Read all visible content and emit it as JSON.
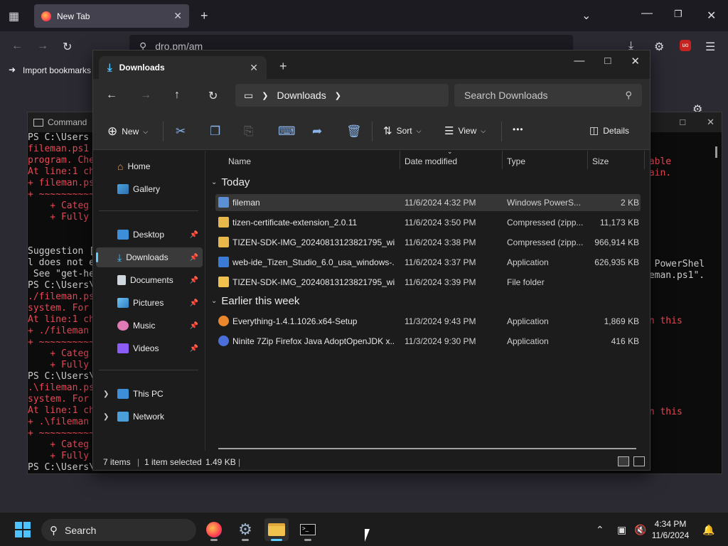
{
  "firefox": {
    "tab_title": "New Tab",
    "url": "dro.pm/am",
    "bookmarks_label": "Import bookmarks"
  },
  "terminal": {
    "title": "Command",
    "lines": [
      {
        "t": "PS C:\\Users",
        "c": "white"
      },
      {
        "t": "fileman.ps1",
        "c": "red"
      },
      {
        "t": "program. Che",
        "c": "red"
      },
      {
        "t": "At line:1 ch",
        "c": "red"
      },
      {
        "t": "+ fileman.ps",
        "c": "red"
      },
      {
        "t": "+ ~~~~~~~~~~",
        "c": "red"
      },
      {
        "t": "    + Categ",
        "c": "red"
      },
      {
        "t": "    + Fully",
        "c": "red"
      },
      {
        "t": "",
        "c": "white"
      },
      {
        "t": "",
        "c": "white"
      },
      {
        "t": "Suggestion [",
        "c": "white"
      },
      {
        "t": "l does not e",
        "c": "white"
      },
      {
        "t": " See \"get-he",
        "c": "white"
      },
      {
        "t": "PS C:\\Users\\",
        "c": "white"
      },
      {
        "t": "./fileman.ps",
        "c": "red"
      },
      {
        "t": "system. For",
        "c": "red"
      },
      {
        "t": "At line:1 ch",
        "c": "red"
      },
      {
        "t": "+ ./fileman",
        "c": "red"
      },
      {
        "t": "+ ~~~~~~~~~~",
        "c": "red"
      },
      {
        "t": "    + Categ",
        "c": "red"
      },
      {
        "t": "    + Fully",
        "c": "red"
      },
      {
        "t": "PS C:\\Users\\",
        "c": "white"
      },
      {
        "t": ".\\fileman.ps",
        "c": "red"
      },
      {
        "t": "system. For",
        "c": "red"
      },
      {
        "t": "At line:1 ch",
        "c": "red"
      },
      {
        "t": "+ .\\fileman",
        "c": "red"
      },
      {
        "t": "+ ~~~~~~~~~~",
        "c": "red"
      },
      {
        "t": "    + Categ",
        "c": "red"
      },
      {
        "t": "    + Fully",
        "c": "red"
      },
      {
        "t": "PS C:\\Users\\",
        "c": "white"
      }
    ],
    "right_lines": [
      {
        "t": "rable",
        "c": "red",
        "row": 1
      },
      {
        "t": "gain.",
        "c": "red",
        "row": 2
      },
      {
        "t": "s PowerShel",
        "c": "white",
        "row": 10
      },
      {
        "t": "leman.ps1\".",
        "c": "white",
        "row": 11
      },
      {
        "t": "on this",
        "c": "red",
        "row": 15
      },
      {
        "t": "on this",
        "c": "red",
        "row": 23
      }
    ]
  },
  "explorer": {
    "tab_title": "Downloads",
    "breadcrumb": "Downloads",
    "search_placeholder": "Search Downloads",
    "toolbar": {
      "new_label": "New",
      "sort_label": "Sort",
      "view_label": "View",
      "details_label": "Details",
      "more_label": "•••"
    },
    "sidebar": {
      "home": "Home",
      "gallery": "Gallery",
      "desktop": "Desktop",
      "downloads": "Downloads",
      "documents": "Documents",
      "pictures": "Pictures",
      "music": "Music",
      "videos": "Videos",
      "this_pc": "This PC",
      "network": "Network"
    },
    "columns": {
      "name": "Name",
      "date": "Date modified",
      "type": "Type",
      "size": "Size"
    },
    "groups": {
      "today": "Today",
      "earlier": "Earlier this week"
    },
    "files": [
      {
        "name": "fileman",
        "date": "11/6/2024 4:32 PM",
        "type": "Windows PowerS...",
        "size": "2 KB",
        "icon": "script-icon",
        "color": "#5b8fd6"
      },
      {
        "name": "tizen-certificate-extension_2.0.11",
        "date": "11/6/2024 3:50 PM",
        "type": "Compressed (zipp...",
        "size": "11,173 KB",
        "icon": "zip-folder-icon",
        "color": "#e8b84a"
      },
      {
        "name": "TIZEN-SDK-IMG_20240813123821795_win...",
        "date": "11/6/2024 3:38 PM",
        "type": "Compressed (zipp...",
        "size": "966,914 KB",
        "icon": "zip-folder-icon",
        "color": "#e8b84a"
      },
      {
        "name": "web-ide_Tizen_Studio_6.0_usa_windows-...",
        "date": "11/6/2024 3:37 PM",
        "type": "Application",
        "size": "626,935 KB",
        "icon": "installer-icon",
        "color": "#3a7bd5"
      },
      {
        "name": "TIZEN-SDK-IMG_20240813123821795_win...",
        "date": "11/6/2024 3:39 PM",
        "type": "File folder",
        "size": "",
        "icon": "folder-icon",
        "color": "#f0c24d"
      },
      {
        "name": "Everything-1.4.1.1026.x64-Setup",
        "date": "11/3/2024 9:43 PM",
        "type": "Application",
        "size": "1,869 KB",
        "icon": "magnifier-app-icon",
        "color": "#e8872c"
      },
      {
        "name": "Ninite 7Zip Firefox Java AdoptOpenJDK x...",
        "date": "11/3/2024 9:30 PM",
        "type": "Application",
        "size": "416 KB",
        "icon": "ninite-icon",
        "color": "#4a6fd8"
      }
    ],
    "status": {
      "items": "7 items",
      "selected": "1 item selected",
      "size": "1.49 KB"
    }
  },
  "taskbar": {
    "search_label": "Search",
    "time": "4:34 PM",
    "date": "11/6/2024"
  }
}
